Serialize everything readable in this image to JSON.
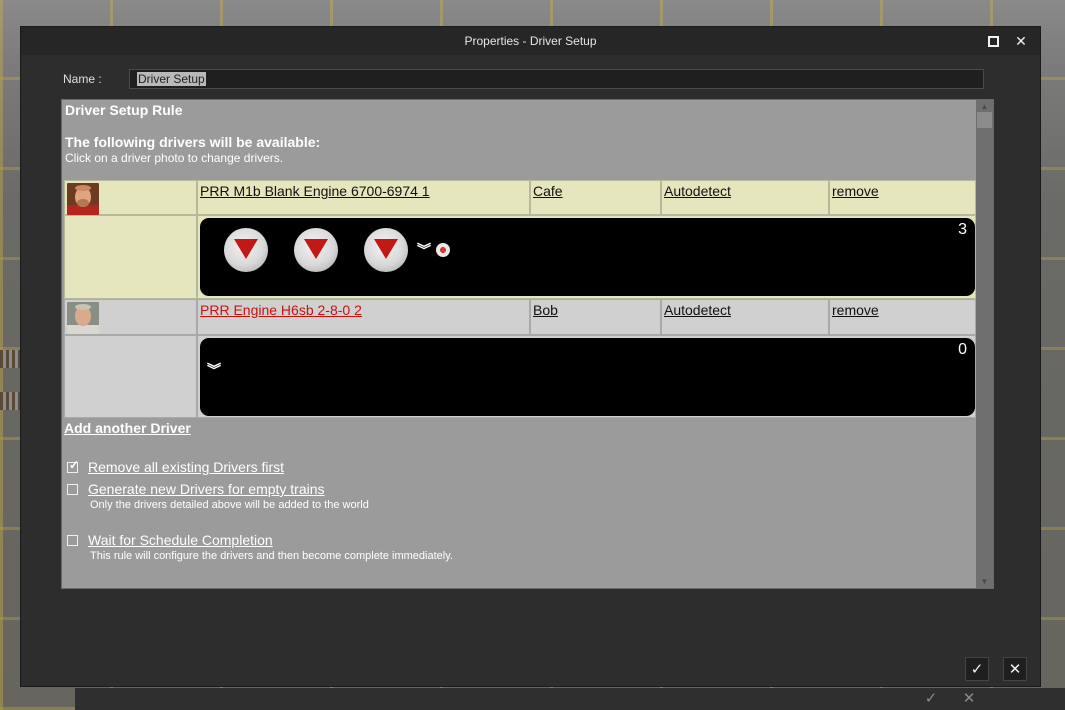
{
  "window": {
    "title": "Properties - Driver Setup",
    "maximize_icon": "maximize-icon",
    "close_icon": "close-icon"
  },
  "name_field": {
    "label": "Name :",
    "value": "Driver Setup"
  },
  "rule": {
    "title": "Driver Setup Rule",
    "heading": "The following drivers will be available:",
    "subheading": "Click on a driver photo to change drivers.",
    "drivers": [
      {
        "train": "PRR M1b Blank Engine 6700-6974 1",
        "driver": "Cafe",
        "mode": "Autodetect",
        "remove": "remove",
        "command_count": "3",
        "commands": 3,
        "row_color": "#e5e5be"
      },
      {
        "train": "PRR Engine H6sb 2-8-0 2",
        "driver": "Bob",
        "mode": "Autodetect",
        "remove": "remove",
        "command_count": "0",
        "commands": 0,
        "row_color": "#d0d0d0",
        "train_color": "#cc1111"
      }
    ],
    "add_driver": "Add another Driver",
    "options": [
      {
        "label": "Remove all existing Drivers first",
        "checked": true,
        "description": ""
      },
      {
        "label": "Generate new Drivers for empty trains",
        "checked": false,
        "description": "Only the drivers detailed above will be added to the world"
      },
      {
        "label": "Wait for Schedule Completion",
        "checked": false,
        "description": "This rule will configure the drivers and then become complete immediately."
      }
    ]
  },
  "footer": {
    "ok_icon": "checkmark-icon",
    "cancel_icon": "close-icon"
  }
}
